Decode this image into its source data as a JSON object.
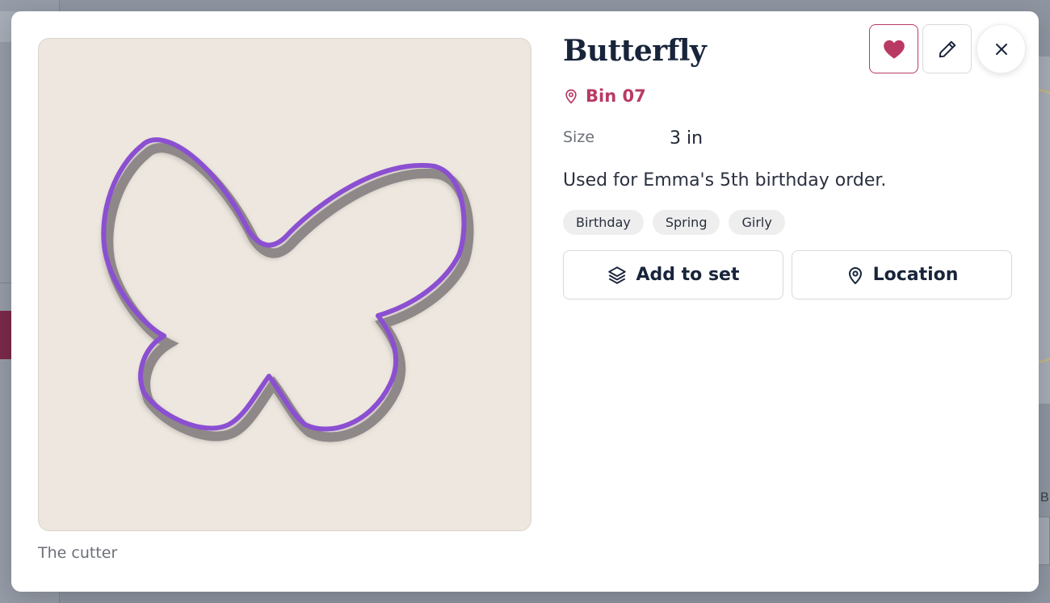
{
  "item": {
    "title": "Butterfly",
    "bin": "Bin 07",
    "size_label": "Size",
    "size_value": "3 in",
    "notes": "Used for Emma's 5th birthday order.",
    "tags": [
      "Birthday",
      "Spring",
      "Girly"
    ],
    "photo_caption": "The cutter"
  },
  "actions": {
    "add_to_set": "Add to set",
    "location": "Location"
  },
  "background": {
    "right_edge_letter": "B"
  },
  "colors": {
    "accent": "#b83a63",
    "title": "#18243a",
    "photo_bg": "#ede7df",
    "cutter": "#8b4fd1"
  },
  "icons": {
    "bin": "map-pin-icon",
    "favorite": "heart-icon",
    "edit": "pencil-icon",
    "close": "close-icon",
    "add_to_set": "layers-icon",
    "location": "map-pin-icon"
  }
}
